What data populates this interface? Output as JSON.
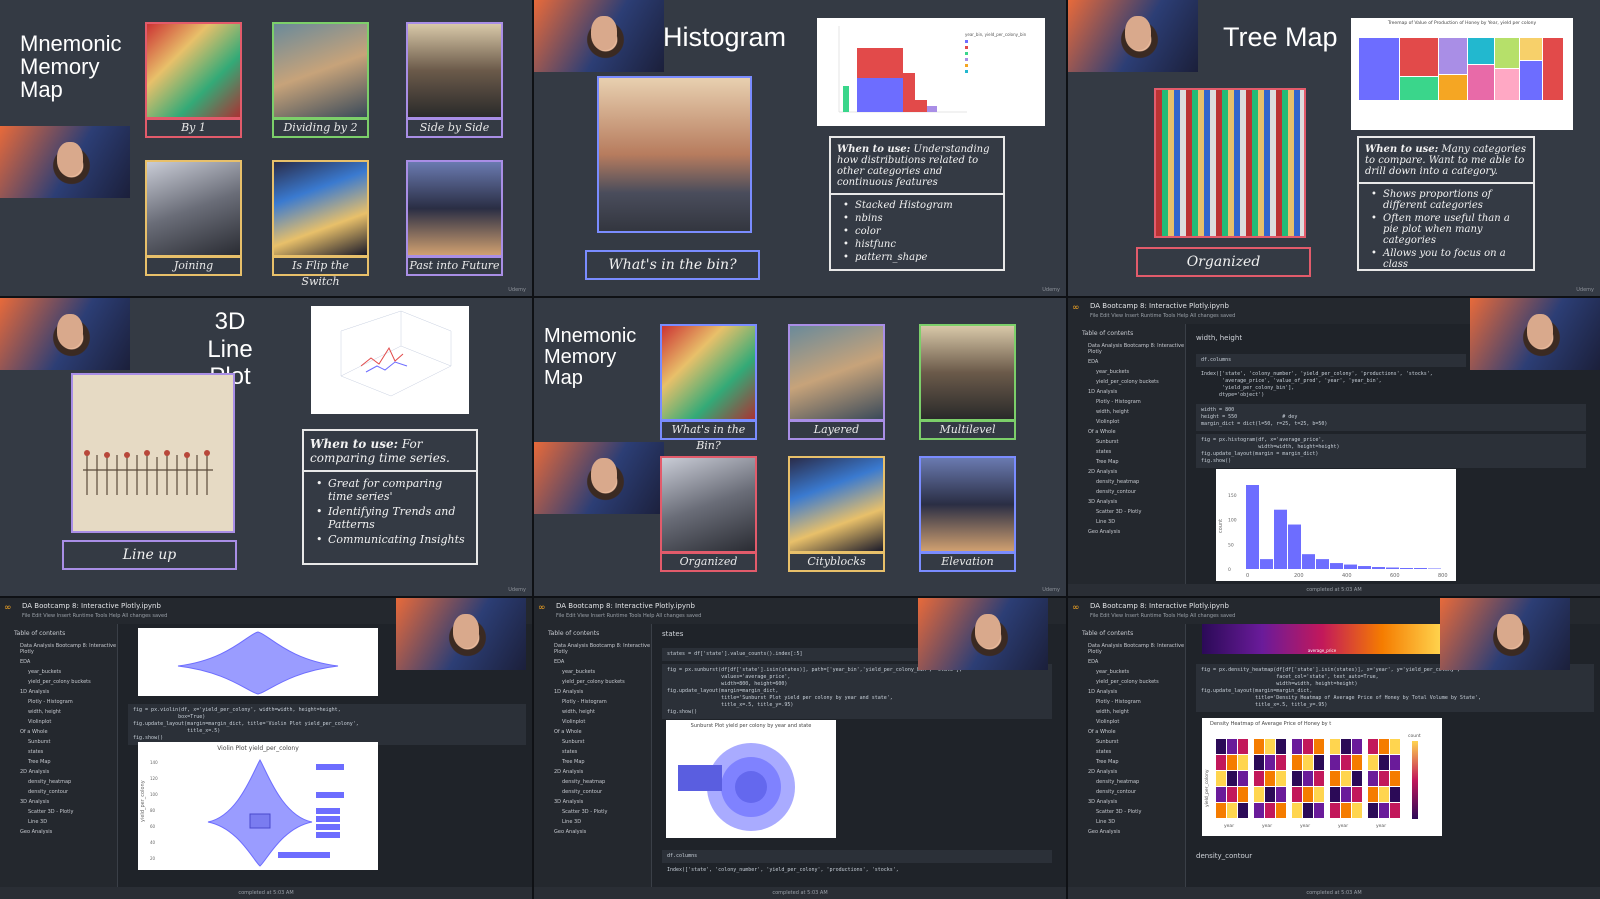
{
  "p1": {
    "title": "Mnemonic Memory Map",
    "tiles": [
      {
        "label": "By 1",
        "color": "#e25b6b"
      },
      {
        "label": "Dividing by 2",
        "color": "#7ccf6a"
      },
      {
        "label": "Side by Side",
        "color": "#a98ee6"
      },
      {
        "label": "Joining",
        "color": "#e8c06a"
      },
      {
        "label": "Is Flip the Switch",
        "color": "#e8c06a"
      },
      {
        "label": "Past into Future",
        "color": "#a98ee6"
      }
    ],
    "watermark": "Udemy"
  },
  "p2": {
    "title": "Histogram",
    "caption": "What's in the bin?",
    "when_label": "When to use:",
    "when_text": "Understanding how distributions related to other categories and continuous features",
    "bullets": [
      "Stacked Histogram",
      "nbins",
      "color",
      "histfunc",
      "pattern_shape"
    ],
    "chart_legend_title": "year_bin, yield_per_colony_bin",
    "watermark": "Udemy"
  },
  "p3": {
    "title": "Tree Map",
    "caption": "Organized",
    "chart_title": "Treemap of Value of Production of Honey by Year, yield per colony",
    "when_label": "When to use:",
    "when_text": "Many categories to compare. Want to me able to drill down into a category.",
    "bullets": [
      "Shows proportions of different categories",
      "Often more useful than a pie plot when many categories",
      "Allows you to focus on a class"
    ],
    "watermark": "Udemy"
  },
  "p4": {
    "title": "3D Line Plot",
    "caption": "Line up",
    "when_label": "When to use:",
    "when_text": "For comparing time series.",
    "bullets": [
      "Great for comparing time series'",
      "Identifying Trends and Patterns",
      "Communicating Insights"
    ],
    "watermark": "Udemy"
  },
  "p5": {
    "title": "Mnemonic Memory Map",
    "tiles": [
      {
        "label": "What's in the Bin?",
        "color": "#7a8cff"
      },
      {
        "label": "Layered",
        "color": "#a98ee6"
      },
      {
        "label": "Multilevel",
        "color": "#7ccf6a"
      },
      {
        "label": "Organized",
        "color": "#e25b6b"
      },
      {
        "label": "Cityblocks",
        "color": "#e8c06a"
      },
      {
        "label": "Elevation",
        "color": "#7a8cff"
      }
    ],
    "watermark": "Udemy"
  },
  "nb": {
    "file": "DA Bootcamp 8: Interactive Plotly.ipynb",
    "menu": "File  Edit  View  Insert  Runtime  Tools  Help  All changes saved",
    "toc_title": "Table of contents",
    "toc": [
      "Data Analysis Bootcamp 8: Interactive Plotly",
      "EDA",
      "year_buckets",
      "yield_per_colony buckets",
      "1D Analysis",
      "Plotly - Histogram",
      "width, height",
      "Violinplot",
      "Of a Whole",
      "Sunburst",
      "states",
      "Tree Map",
      "2D Analysis",
      "density_heatmap",
      "density_contour",
      "3D Analysis",
      "Scatter 3D - Plotly",
      "Line 3D",
      "Geo Analysis"
    ],
    "status": "completed at 5:03 AM"
  },
  "p6": {
    "heading": "width, height",
    "code1": "df.columns",
    "code2": "Index(['state', 'colony_number', 'yield_per_colony', 'productions', 'stocks',\n       'average_price', 'value_of_prod', 'year', 'year_bin',\n       'yield_per_colony_bin'],\n      dtype='object')",
    "code3": "width = 800\nheight = 550               # dey\nmargin_dict = dict(l=50, r=25, t=25, b=50)",
    "code4": "fig = px.histogram(df, x='average_price',\n                   width=width, height=height)\nfig.update_layout(margin = margin_dict)\nfig.show()",
    "chart_data": {
      "type": "bar",
      "values": [
        170,
        20,
        120,
        90,
        30,
        20,
        12,
        9,
        6,
        4,
        3,
        2,
        2,
        1
      ],
      "xticks": [
        "0",
        "200",
        "400",
        "600",
        "800"
      ],
      "ylabel": "count",
      "yticks": [
        "150",
        "100",
        "50",
        "0"
      ]
    }
  },
  "p7": {
    "code": "fig = px.violin(df, x='yield_per_colony', width=width, height=height,\n               box=True)\nfig.update_layout(margin=margin_dict, title='Violin Plot yield_per_colony',\n                  title_x=.5)\nfig.show()",
    "chart_title": "Violin Plot yield_per_colony",
    "ylabel": "yield_per_colony",
    "yticks": [
      "140",
      "120",
      "100",
      "80",
      "60",
      "40",
      "20"
    ]
  },
  "p8": {
    "heading": "states",
    "code": "fig = px.sunburst(df[df['state'].isin(states)], path=['year_bin','yield_per_colony_bin', 'state'],\n                  values='average_price',\n                  width=800, height=600)\nfig.update_layout(margin=margin_dict,\n                  title='Sunburst Plot yield per colony by year and state',\n                  title_x=.5, title_y=.95)\nfig.show()",
    "chart_title": "Sunburst Plot yield per colony by year and state",
    "code2": "df.columns",
    "code3": "Index(['state', 'colony_number', 'yield_per_colony', 'productions', 'stocks',"
  },
  "p9": {
    "code": "fig = px.density_heatmap(df[df['state'].isin(states)], x='year', y='yield_per_colony',\n                         facet_col='state', text_auto=True,\n                         width=width, height=height)\nfig.update_layout(margin=margin_dict,\n                  title='Density Heatmap of Average Price of Honey by Total Volume by State',\n                  title_x=.5, title_y=.95)",
    "chart_title": "Density Heatmap of Average Price of Honey by t",
    "heading": "density_contour",
    "xlabel": "average_price",
    "facet_xlabel": "year",
    "ylabel": "yield_per_colony",
    "colorbar_label": "count",
    "colors": {
      "bg": "#1f2329",
      "accent": "#f5a623"
    }
  }
}
